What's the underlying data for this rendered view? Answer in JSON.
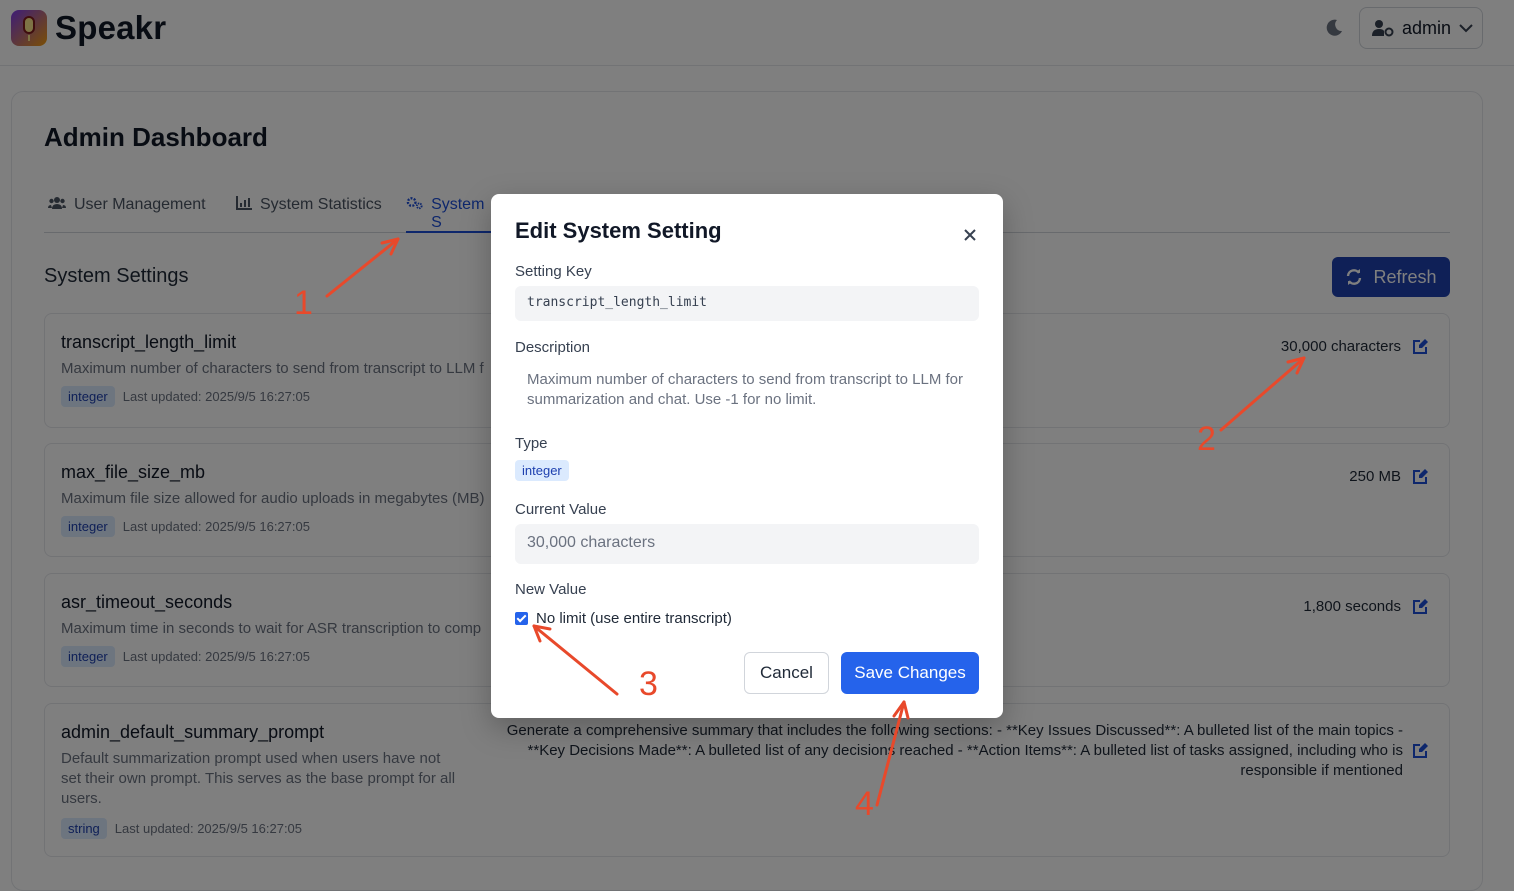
{
  "header": {
    "brand": "Speakr",
    "user_label": "admin"
  },
  "page": {
    "title": "Admin Dashboard",
    "tabs": [
      {
        "label": "User Management"
      },
      {
        "label": "System Statistics"
      },
      {
        "label": "System S"
      }
    ],
    "section_title": "System Settings",
    "refresh_label": "Refresh"
  },
  "settings": [
    {
      "name": "transcript_length_limit",
      "description": "Maximum number of characters to send from transcript to LLM f",
      "type": "integer",
      "updated": "Last updated: 2025/9/5 16:27:05",
      "value": "30,000 characters"
    },
    {
      "name": "max_file_size_mb",
      "description": "Maximum file size allowed for audio uploads in megabytes (MB)",
      "type": "integer",
      "updated": "Last updated: 2025/9/5 16:27:05",
      "value": "250 MB"
    },
    {
      "name": "asr_timeout_seconds",
      "description": "Maximum time in seconds to wait for ASR transcription to comp",
      "type": "integer",
      "updated": "Last updated: 2025/9/5 16:27:05",
      "value": "1,800 seconds"
    },
    {
      "name": "admin_default_summary_prompt",
      "description": "Default summarization prompt used when users have not set their own prompt. This serves as the base prompt for all users.",
      "type": "string",
      "updated": "Last updated: 2025/9/5 16:27:05",
      "value": "Generate a comprehensive summary that includes the following sections: - **Key Issues Discussed**: A bulleted list of the main topics - **Key Decisions Made**: A bulleted list of any decisions reached - **Action Items**: A bulleted list of tasks assigned, including who is responsible if mentioned"
    }
  ],
  "modal": {
    "title": "Edit System Setting",
    "key_label": "Setting Key",
    "key_value": "transcript_length_limit",
    "description_label": "Description",
    "description_value": "Maximum number of characters to send from transcript to LLM for summarization and chat. Use -1 for no limit.",
    "type_label": "Type",
    "type_value": "integer",
    "current_label": "Current Value",
    "current_value": "30,000 characters",
    "new_label": "New Value",
    "checkbox_label": "No limit (use entire transcript)",
    "checkbox_checked": true,
    "cancel_label": "Cancel",
    "save_label": "Save Changes"
  },
  "annotations": {
    "n1": "1",
    "n2": "2",
    "n3": "3",
    "n4": "4",
    "color": "#e8492b"
  }
}
